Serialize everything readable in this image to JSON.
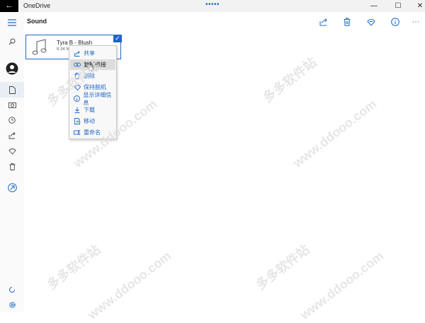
{
  "window": {
    "title": "OneDrive",
    "back_glyph": "←",
    "drag_glyph": "•••••",
    "minimize": "—",
    "maximize": "☐",
    "close": "✕"
  },
  "header": {
    "title": "Sound"
  },
  "toolbar": {
    "more": "···"
  },
  "file": {
    "name": "Tyra B - Blush",
    "size": "8.34 M",
    "check": "✓"
  },
  "context_menu": {
    "items": [
      {
        "label": "共享",
        "icon": "share-icon"
      },
      {
        "label": "复制链接",
        "icon": "link-icon"
      },
      {
        "label": "删除",
        "icon": "trash-icon"
      },
      {
        "label": "保持脱机",
        "icon": "offline-icon"
      },
      {
        "label": "显示详细信息",
        "icon": "info-icon"
      },
      {
        "label": "下载",
        "icon": "download-icon"
      },
      {
        "label": "移动",
        "icon": "move-icon"
      },
      {
        "label": "重命名",
        "icon": "rename-icon"
      }
    ]
  },
  "watermarks": [
    "多多软件站",
    "www.ddooo.com"
  ],
  "colors": {
    "accent": "#1e67c5",
    "menu_hover": "#dcdcdc"
  }
}
